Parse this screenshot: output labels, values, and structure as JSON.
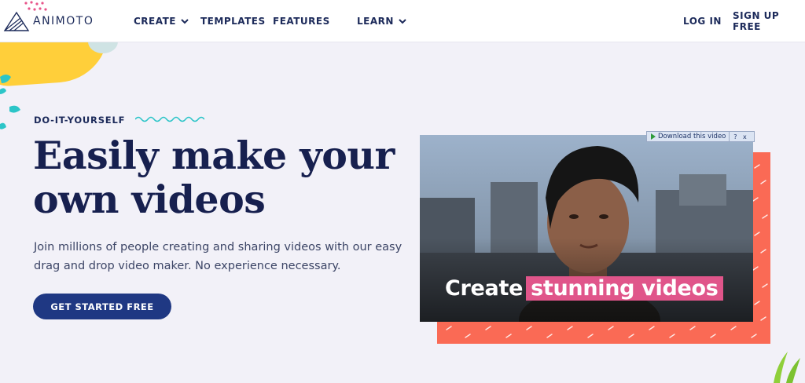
{
  "brand": {
    "name": "ANIMOTO"
  },
  "nav": {
    "create": "CREATE",
    "templates": "TEMPLATES",
    "features": "FEATURES",
    "learn": "LEARN",
    "login": "LOG IN",
    "signup": "SIGN UP FREE"
  },
  "hero": {
    "eyebrow": "DO-IT-YOURSELF",
    "headline": "Easily make your own videos",
    "subtext": "Join millions of people creating and sharing videos with our easy drag and drop video maker. No experience necessary.",
    "cta": "GET STARTED FREE"
  },
  "video": {
    "caption_plain": "Create",
    "caption_highlight": "stunning videos"
  },
  "download_bar": {
    "label": "Download this video",
    "help": "?",
    "close": "x"
  },
  "colors": {
    "navy": "#1c2a5a",
    "cta": "#1f3883",
    "coral": "#fa6a55",
    "highlight": "#e0558a",
    "yellow": "#ffcf3a",
    "teal": "#2cc5c8"
  }
}
